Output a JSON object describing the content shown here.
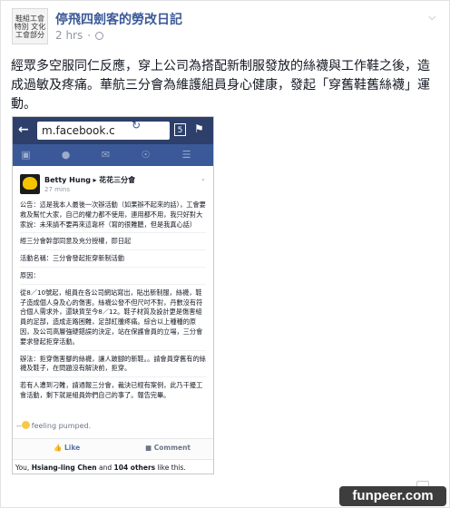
{
  "post": {
    "page_name": "停飛四劍客的勞改日記",
    "avatar_text": "鞋組工會特別 文化工會部分",
    "timestamp": "2 hrs",
    "separator": "·",
    "body": "經眾多空服同仁反應，穿上公司為搭配新制服發放的絲襪與工作鞋之後，造成過敏及疼痛。華航三分會為維護組員身心健康，發起「穿舊鞋舊絲襪」運動。"
  },
  "screenshot": {
    "url": "m.facebook.c",
    "tab_count": "5",
    "poster_name": "Betty Hung",
    "poster_arrow": "▸",
    "poster_group": "花花三分會",
    "poster_time": "27 mins",
    "paragraphs": [
      "公告：這是我本人最後一次辦活動（如果辦不起來的話），工會要救及幫忙大家，自己的權力都不使用，連用都不用，我只好對大家說：未來請不要再來這靠杯（寫的很難聽，但是我真心話）",
      "經三分會幹部同意及充分授權，即日起",
      "活動名稱：三分會發起拒穿新制活動",
      "原因：",
      "從8／10號起，組員在各公司網站寫出，貼出新制服，絲襪，鞋子造成個人身及心的傷害。絲襪公發不但尺吋不對，丹數沒有符合個人需求外，還缺貨至今8／12。鞋子材質及設計更是傷害組員的足部，造成走路困難，足部紅腫疼痛。綜合以上種種的原因，及公司高層強硬錯誤的決定，站在保護會員的立場，三分會要求發起拒穿活動。",
      "辦法：拒穿傷害腳的絲襪，讓人跛腳的新鞋。。請會員穿舊有的絲襪及鞋子，在問題沒有解決前，拒穿。",
      "若有人遭到刁難，請通報三分會，裁決已經有案例，此乃干擾工會活動，剩下就是組員妳們自己的事了。報告完畢。"
    ],
    "feeling": "feeling pumped.",
    "like_label": "Like",
    "comment_label": "Comment",
    "likes_prefix": "You, ",
    "likes_name": "Hsiang-ling Chen",
    "likes_mid": " and ",
    "likes_others": "104 others",
    "likes_suffix": " like this."
  },
  "watermark": "funpeer.com"
}
